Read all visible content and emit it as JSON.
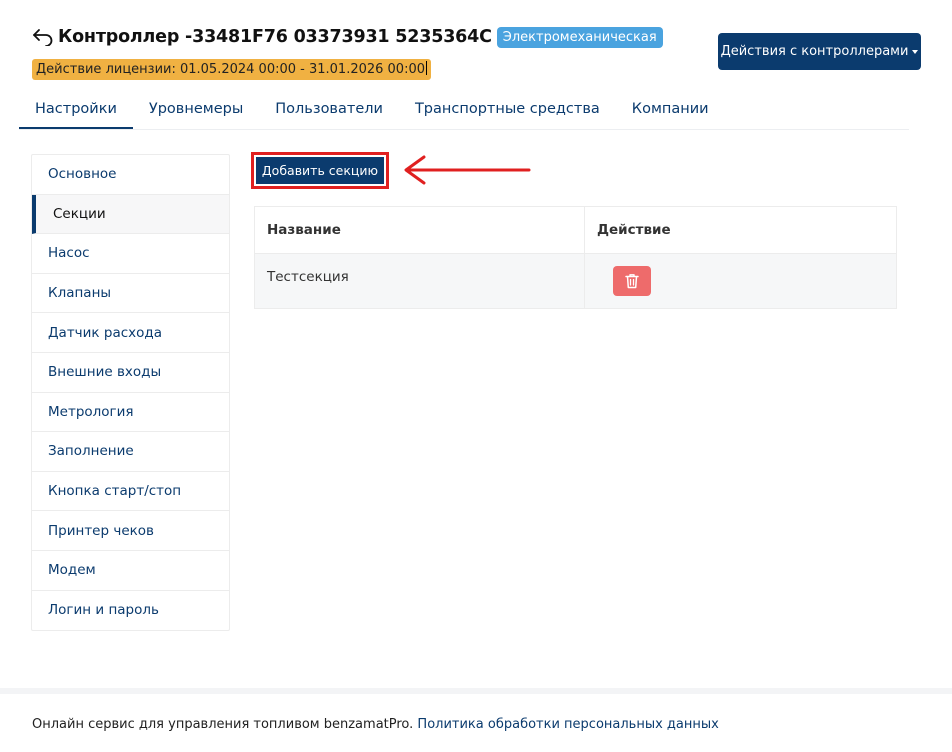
{
  "header": {
    "title": "Контроллер -33481F76 03373931 5235364C",
    "type_badge": "Электромеханическая",
    "license": "Действие лицензии: 01.05.2024 00:00 - 31.01.2026 00:00",
    "actions_label": "Действия с контроллерами"
  },
  "tabs": [
    {
      "label": "Настройки",
      "active": true
    },
    {
      "label": "Уровнемеры"
    },
    {
      "label": "Пользователи"
    },
    {
      "label": "Транспортные средства"
    },
    {
      "label": "Компании"
    }
  ],
  "sidebar": {
    "items": [
      {
        "label": "Основное"
      },
      {
        "label": "Секции",
        "active": true
      },
      {
        "label": "Насос"
      },
      {
        "label": "Клапаны"
      },
      {
        "label": "Датчик расхода"
      },
      {
        "label": "Внешние входы"
      },
      {
        "label": "Метрология"
      },
      {
        "label": "Заполнение"
      },
      {
        "label": "Кнопка старт/стоп"
      },
      {
        "label": "Принтер чеков"
      },
      {
        "label": "Модем"
      },
      {
        "label": "Логин и пароль"
      }
    ]
  },
  "main": {
    "add_label": "Добавить секцию",
    "table": {
      "columns": [
        "Название",
        "Действие"
      ],
      "rows": [
        {
          "name": "Тестсекция",
          "action_icon": "trash-icon"
        }
      ]
    }
  },
  "footer": {
    "text": "Онлайн сервис для управления топливом benzamatPro.",
    "link": "Политика обработки персональных данных"
  },
  "colors": {
    "primary": "#0b3b6e",
    "badge": "#4aa3df",
    "license": "#f0b142",
    "danger": "#ee6b6b",
    "highlight": "#e02020"
  }
}
